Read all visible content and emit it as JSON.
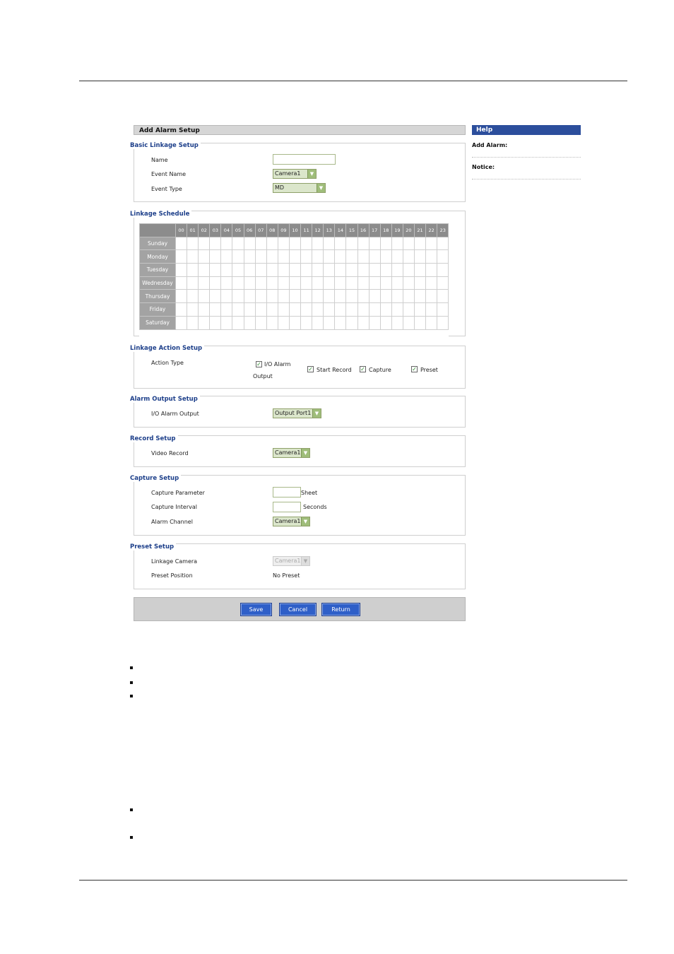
{
  "header": {
    "title": "Add Alarm Setup"
  },
  "help": {
    "title": "Help",
    "add_alarm": "Add Alarm:",
    "notice": "Notice:"
  },
  "basic": {
    "title": "Basic Linkage Setup",
    "name_label": "Name",
    "name_value": "",
    "event_name_label": "Event Name",
    "event_name_value": "Camera1",
    "event_type_label": "Event Type",
    "event_type_value": "MD"
  },
  "schedule": {
    "title": "Linkage Schedule",
    "hours": [
      "00",
      "01",
      "02",
      "03",
      "04",
      "05",
      "06",
      "07",
      "08",
      "09",
      "10",
      "11",
      "12",
      "13",
      "14",
      "15",
      "16",
      "17",
      "18",
      "19",
      "20",
      "21",
      "22",
      "23"
    ],
    "days": [
      "Sunday",
      "Monday",
      "Tuesday",
      "Wednesday",
      "Thursday",
      "Friday",
      "Saturday"
    ]
  },
  "action": {
    "title": "Linkage Action Setup",
    "label": "Action Type",
    "io_alarm": "I/O Alarm",
    "io_alarm_2": "Output",
    "start_record": "Start Record",
    "capture": "Capture",
    "preset": "Preset",
    "io_checked": true,
    "record_checked": true,
    "capture_checked": true,
    "preset_checked": true
  },
  "alarm_output": {
    "title": "Alarm Output Setup",
    "label": "I/O Alarm Output",
    "value": "Output Port1"
  },
  "record": {
    "title": "Record Setup",
    "label": "Video Record",
    "value": "Camera1"
  },
  "capture_setup": {
    "title": "Capture Setup",
    "param_label": "Capture Parameter",
    "param_value": "",
    "param_unit": "Sheet",
    "interval_label": "Capture Interval",
    "interval_value": "",
    "interval_unit": "Seconds",
    "channel_label": "Alarm Channel",
    "channel_value": "Camera1"
  },
  "preset_setup": {
    "title": "Preset Setup",
    "camera_label": "Linkage Camera",
    "camera_value": "Camera1",
    "position_label": "Preset Position",
    "position_value": "No Preset"
  },
  "buttons": {
    "save": "Save",
    "cancel": "Cancel",
    "return": "Return"
  },
  "colors": {
    "accent": "#2f5fc8",
    "help_bar": "#2c4e9c",
    "section_title": "#1d3f8a",
    "select_bg": "#dbe6cb"
  }
}
